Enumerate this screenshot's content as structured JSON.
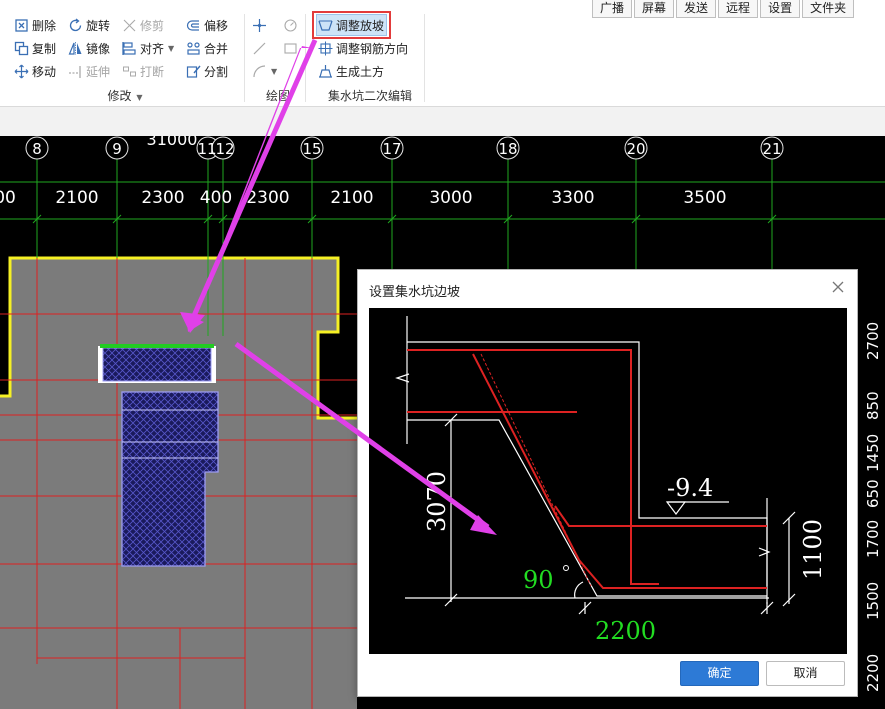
{
  "ribbon": {
    "modify": {
      "delete": "删除",
      "rotate": "旋转",
      "trim": "修剪",
      "offset": "偏移",
      "copy": "复制",
      "mirror": "镜像",
      "align": "对齐",
      "merge": "合并",
      "move": "移动",
      "extend": "延伸",
      "break": "打断",
      "split": "分割",
      "group_label": "修改"
    },
    "draw": {
      "group_label": "绘图"
    },
    "pit": {
      "adjust_slope": "调整放坡",
      "adjust_rebar": "调整钢筋方向",
      "gen_earth": "生成土方",
      "group_label": "集水坑二次编辑"
    }
  },
  "quickbar": [
    "广播",
    "屏幕",
    "发送",
    "远程",
    "设置",
    "文件夹"
  ],
  "canvas": {
    "axis_numbers": [
      "8",
      "9",
      "11",
      "12",
      "15",
      "17",
      "18",
      "20",
      "21"
    ],
    "top_dimension": "31000",
    "spans": [
      "00",
      "2100",
      "2300",
      "400",
      "2300",
      "2100",
      "3000",
      "3300",
      "3500"
    ],
    "right_dims": [
      "2700",
      "850",
      "1450",
      "650",
      "1700",
      "1500",
      "2200"
    ]
  },
  "dialog": {
    "title": "设置集水坑边坡",
    "preview": {
      "depth_label": "3070",
      "elevation_label": "-9.4",
      "angle_label": "90",
      "bottom_label": "2200",
      "right_label": "1100"
    },
    "ok_label": "确定",
    "cancel_label": "取消"
  },
  "colors": {
    "highlight": "#e23b3b",
    "arrow": "#e040e8",
    "cad_yellow": "#f5f024",
    "cad_green": "#22cc22",
    "cad_red": "#dd2222",
    "primary_button": "#2d7ad6"
  }
}
